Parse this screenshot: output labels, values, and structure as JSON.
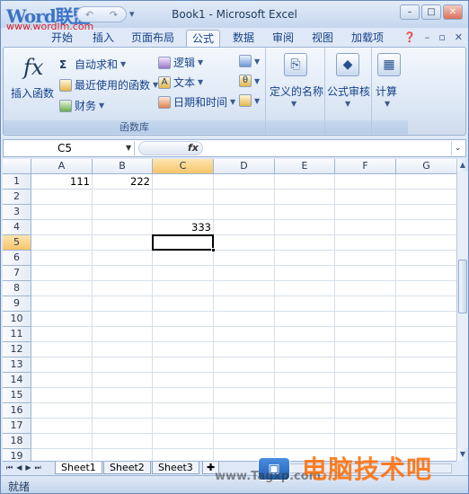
{
  "window": {
    "title": "Book1 - Microsoft Excel",
    "watermark_logo": "Word联盟",
    "watermark_url": "www.wordlm.com",
    "min_label": "–",
    "max_label": "□",
    "close_label": "✕"
  },
  "ribbon_tabs": [
    "开始",
    "插入",
    "页面布局",
    "公式",
    "数据",
    "审阅",
    "视图",
    "加载项"
  ],
  "active_tab": "公式",
  "ribbon": {
    "insert_function": "插入函数",
    "autosum": "自动求和",
    "recent": "最近使用的函数",
    "financial": "财务",
    "logical": "逻辑",
    "text": "文本",
    "datetime": "日期和时间",
    "group_function_library": "函数库",
    "defined_names": "定义的名称",
    "formula_auditing": "公式审核",
    "calculation": "计算"
  },
  "formula_bar": {
    "name_box": "C5",
    "fx": "fx",
    "formula": ""
  },
  "columns": [
    "A",
    "B",
    "C",
    "D",
    "E",
    "F",
    "G"
  ],
  "rows": [
    "1",
    "2",
    "3",
    "4",
    "5",
    "6",
    "7",
    "8",
    "9",
    "10",
    "11",
    "12",
    "13",
    "14",
    "15",
    "16",
    "17",
    "18",
    "19"
  ],
  "cells": {
    "A1": "111",
    "B1": "222",
    "C4": "333"
  },
  "active_cell": "C5",
  "sheets": [
    "Sheet1",
    "Sheet2",
    "Sheet3"
  ],
  "active_sheet": "Sheet1",
  "status": "就绪",
  "watermarks": {
    "site_text": "www.Tagxp.com",
    "brand_text": "电脑技术吧"
  }
}
